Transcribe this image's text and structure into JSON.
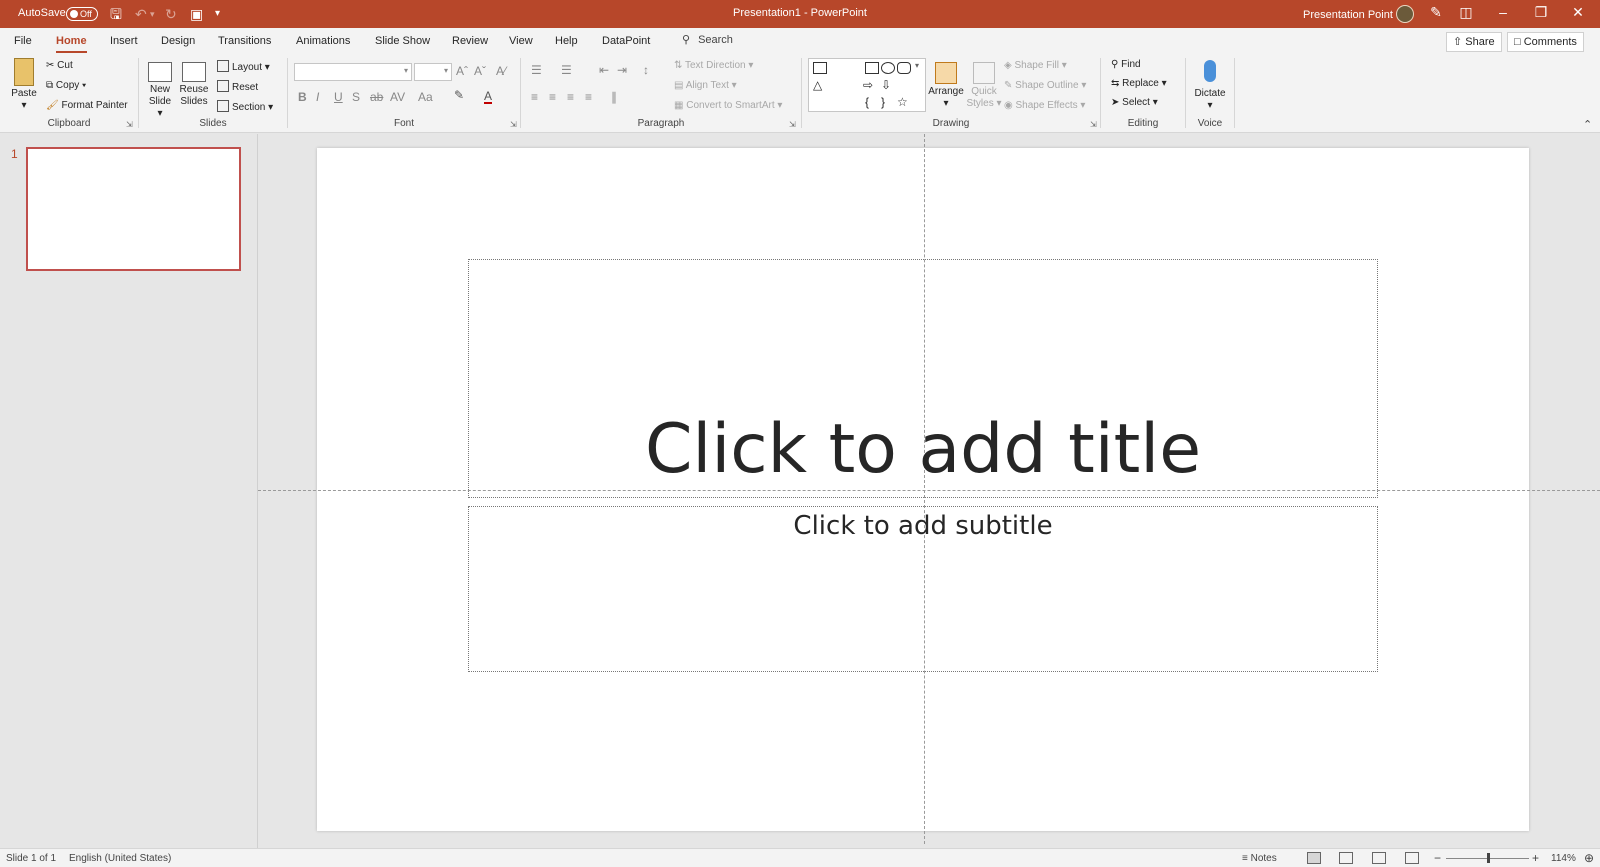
{
  "titlebar": {
    "autosave_label": "AutoSave",
    "autosave_state": "Off",
    "doc_title": "Presentation1  -  PowerPoint",
    "user_name": "Presentation Point",
    "accent": "#b7472a"
  },
  "tabs": [
    "File",
    "Home",
    "Insert",
    "Design",
    "Transitions",
    "Animations",
    "Slide Show",
    "Review",
    "View",
    "Help",
    "DataPoint"
  ],
  "active_tab": "Home",
  "search_label": "Search",
  "share_label": "Share",
  "comments_label": "Comments",
  "ribbon": {
    "clipboard": {
      "paste": "Paste",
      "cut": "Cut",
      "copy": "Copy",
      "format_painter": "Format Painter",
      "group": "Clipboard"
    },
    "slides": {
      "new_slide_1": "New",
      "new_slide_2": "Slide",
      "reuse_1": "Reuse",
      "reuse_2": "Slides",
      "layout": "Layout",
      "reset": "Reset",
      "section": "Section",
      "group": "Slides"
    },
    "font": {
      "group": "Font"
    },
    "paragraph": {
      "text_direction": "Text Direction",
      "align_text": "Align Text",
      "convert_smartart": "Convert to SmartArt",
      "group": "Paragraph"
    },
    "drawing": {
      "arrange": "Arrange",
      "quick_1": "Quick",
      "quick_2": "Styles",
      "shape_fill": "Shape Fill",
      "shape_outline": "Shape Outline",
      "shape_effects": "Shape Effects",
      "group": "Drawing"
    },
    "editing": {
      "find": "Find",
      "replace": "Replace",
      "select": "Select",
      "group": "Editing"
    },
    "voice": {
      "dictate": "Dictate",
      "group": "Voice"
    }
  },
  "thumbnails": [
    {
      "number": "1"
    }
  ],
  "slide": {
    "title_placeholder": "Click to add title",
    "subtitle_placeholder": "Click to add subtitle"
  },
  "statusbar": {
    "slide_info": "Slide 1 of 1",
    "language": "English (United States)",
    "notes": "Notes",
    "zoom": "114%"
  }
}
